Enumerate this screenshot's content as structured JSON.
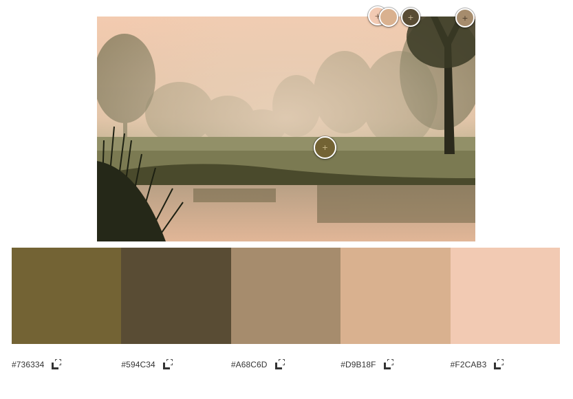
{
  "palette": {
    "swatches": [
      {
        "hex": "#736334",
        "color": "#736334"
      },
      {
        "hex": "#594C34",
        "color": "#594C34"
      },
      {
        "hex": "#A68C6D",
        "color": "#A68C6D"
      },
      {
        "hex": "#D9B18F",
        "color": "#D9B18F"
      },
      {
        "hex": "#F2CAB3",
        "color": "#F2CAB3"
      }
    ]
  },
  "pickers": [
    {
      "color": "#F2CAB3",
      "icon": "plus-icon"
    },
    {
      "color": "#D9B18F",
      "icon": "plus-icon"
    },
    {
      "color": "#594C34",
      "icon": "plus-icon"
    },
    {
      "color": "#A68C6D",
      "icon": "plus-icon"
    },
    {
      "color": "#736334",
      "icon": "plus-icon"
    }
  ],
  "photo": {
    "subject": "misty meadow with trees reflected in a pond at dawn"
  },
  "icons": {
    "copy": "copy-icon",
    "picker": "plus-icon"
  }
}
